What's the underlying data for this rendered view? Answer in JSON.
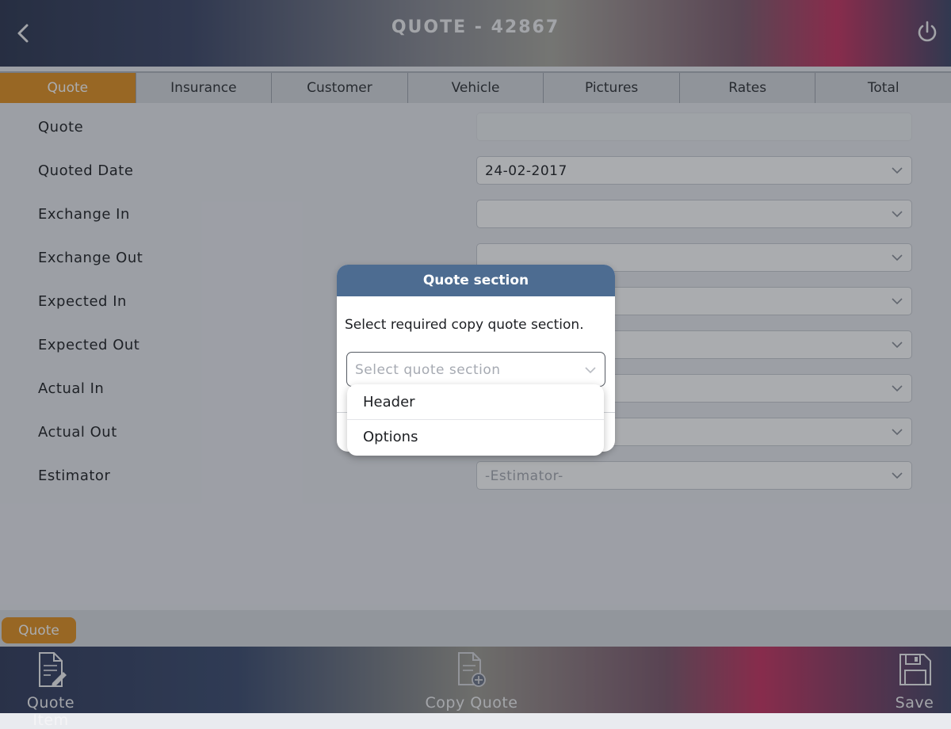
{
  "header": {
    "title": "QUOTE - 42867",
    "back_icon": "chevron-left-icon",
    "power_icon": "power-icon"
  },
  "tabs": [
    {
      "label": "Quote",
      "active": true
    },
    {
      "label": "Insurance",
      "active": false
    },
    {
      "label": "Customer",
      "active": false
    },
    {
      "label": "Vehicle",
      "active": false
    },
    {
      "label": "Pictures",
      "active": false
    },
    {
      "label": "Rates",
      "active": false
    },
    {
      "label": "Total",
      "active": false
    }
  ],
  "form": {
    "rows": [
      {
        "label": "Quote",
        "value": "",
        "placeholder": ""
      },
      {
        "label": "Quoted Date",
        "value": "24-02-2017",
        "placeholder": ""
      },
      {
        "label": "Exchange In",
        "value": "",
        "placeholder": ""
      },
      {
        "label": "Exchange Out",
        "value": "",
        "placeholder": ""
      },
      {
        "label": "Expected In",
        "value": "",
        "placeholder": ""
      },
      {
        "label": "Expected Out",
        "value": "",
        "placeholder": ""
      },
      {
        "label": "Actual In",
        "value": "",
        "placeholder": ""
      },
      {
        "label": "Actual Out",
        "value": "",
        "placeholder": ""
      },
      {
        "label": "Estimator",
        "value": "",
        "placeholder": "-Estimator-"
      }
    ]
  },
  "bottom": {
    "chip_label": "Quote"
  },
  "footer": {
    "quote_item_label": "Quote Item",
    "copy_quote_label": "Copy Quote",
    "save_label": "Save"
  },
  "dialog": {
    "title": "Quote section",
    "message": "Select required copy quote section.",
    "select_placeholder": "Select quote section",
    "options": [
      "Header",
      "Options"
    ]
  },
  "colors": {
    "accent_orange": "#e39020",
    "dialog_header": "#4d6c91"
  }
}
